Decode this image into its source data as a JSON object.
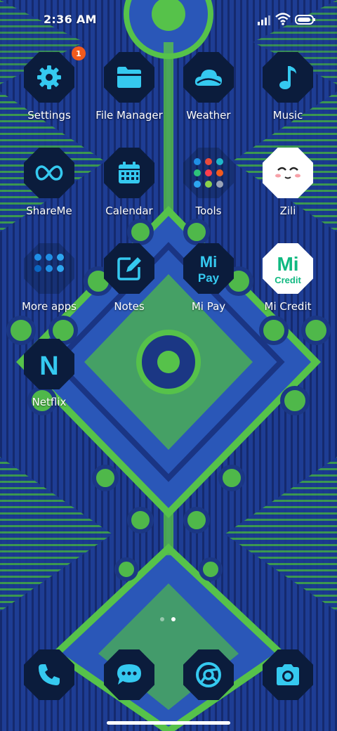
{
  "status_bar": {
    "time": "2:36 AM",
    "icons": [
      "signal-bars-icon",
      "wifi-icon",
      "battery-icon"
    ]
  },
  "apps": [
    {
      "name": "Settings",
      "icon": "gear-icon",
      "badge": "1"
    },
    {
      "name": "File Manager",
      "icon": "folder-icon"
    },
    {
      "name": "Weather",
      "icon": "cloud-icon"
    },
    {
      "name": "Music",
      "icon": "music-note-icon"
    },
    {
      "name": "ShareMe",
      "icon": "infinity-icon"
    },
    {
      "name": "Calendar",
      "icon": "calendar-icon"
    },
    {
      "name": "Tools",
      "icon": "folder-grid-icon"
    },
    {
      "name": "Zili",
      "icon": "zili-face-icon"
    },
    {
      "name": "More apps",
      "icon": "folder-grid-icon"
    },
    {
      "name": "Notes",
      "icon": "notes-edit-icon"
    },
    {
      "name": "Mi Pay",
      "icon": "mi-pay-logo",
      "logo_top": "Mi",
      "logo_bottom": "Pay"
    },
    {
      "name": "Mi Credit",
      "icon": "mi-credit-logo",
      "logo_top": "Mi",
      "logo_bottom": "Credit"
    },
    {
      "name": "Netflix",
      "icon": "netflix-n-icon",
      "logo_text": "N"
    }
  ],
  "dock": [
    {
      "name": "Phone",
      "icon": "phone-icon"
    },
    {
      "name": "Messages",
      "icon": "message-bubble-icon"
    },
    {
      "name": "Chrome",
      "icon": "chrome-icon"
    },
    {
      "name": "Camera",
      "icon": "camera-icon"
    }
  ],
  "page_indicator": {
    "pages": 2,
    "current": 2
  },
  "colors": {
    "wallpaper_blue": "#1c3a8e",
    "wallpaper_green": "#4fb84a",
    "icon_tile": "#0b1c3c",
    "icon_accent": "#35c9f0",
    "badge": "#f25a1d"
  }
}
